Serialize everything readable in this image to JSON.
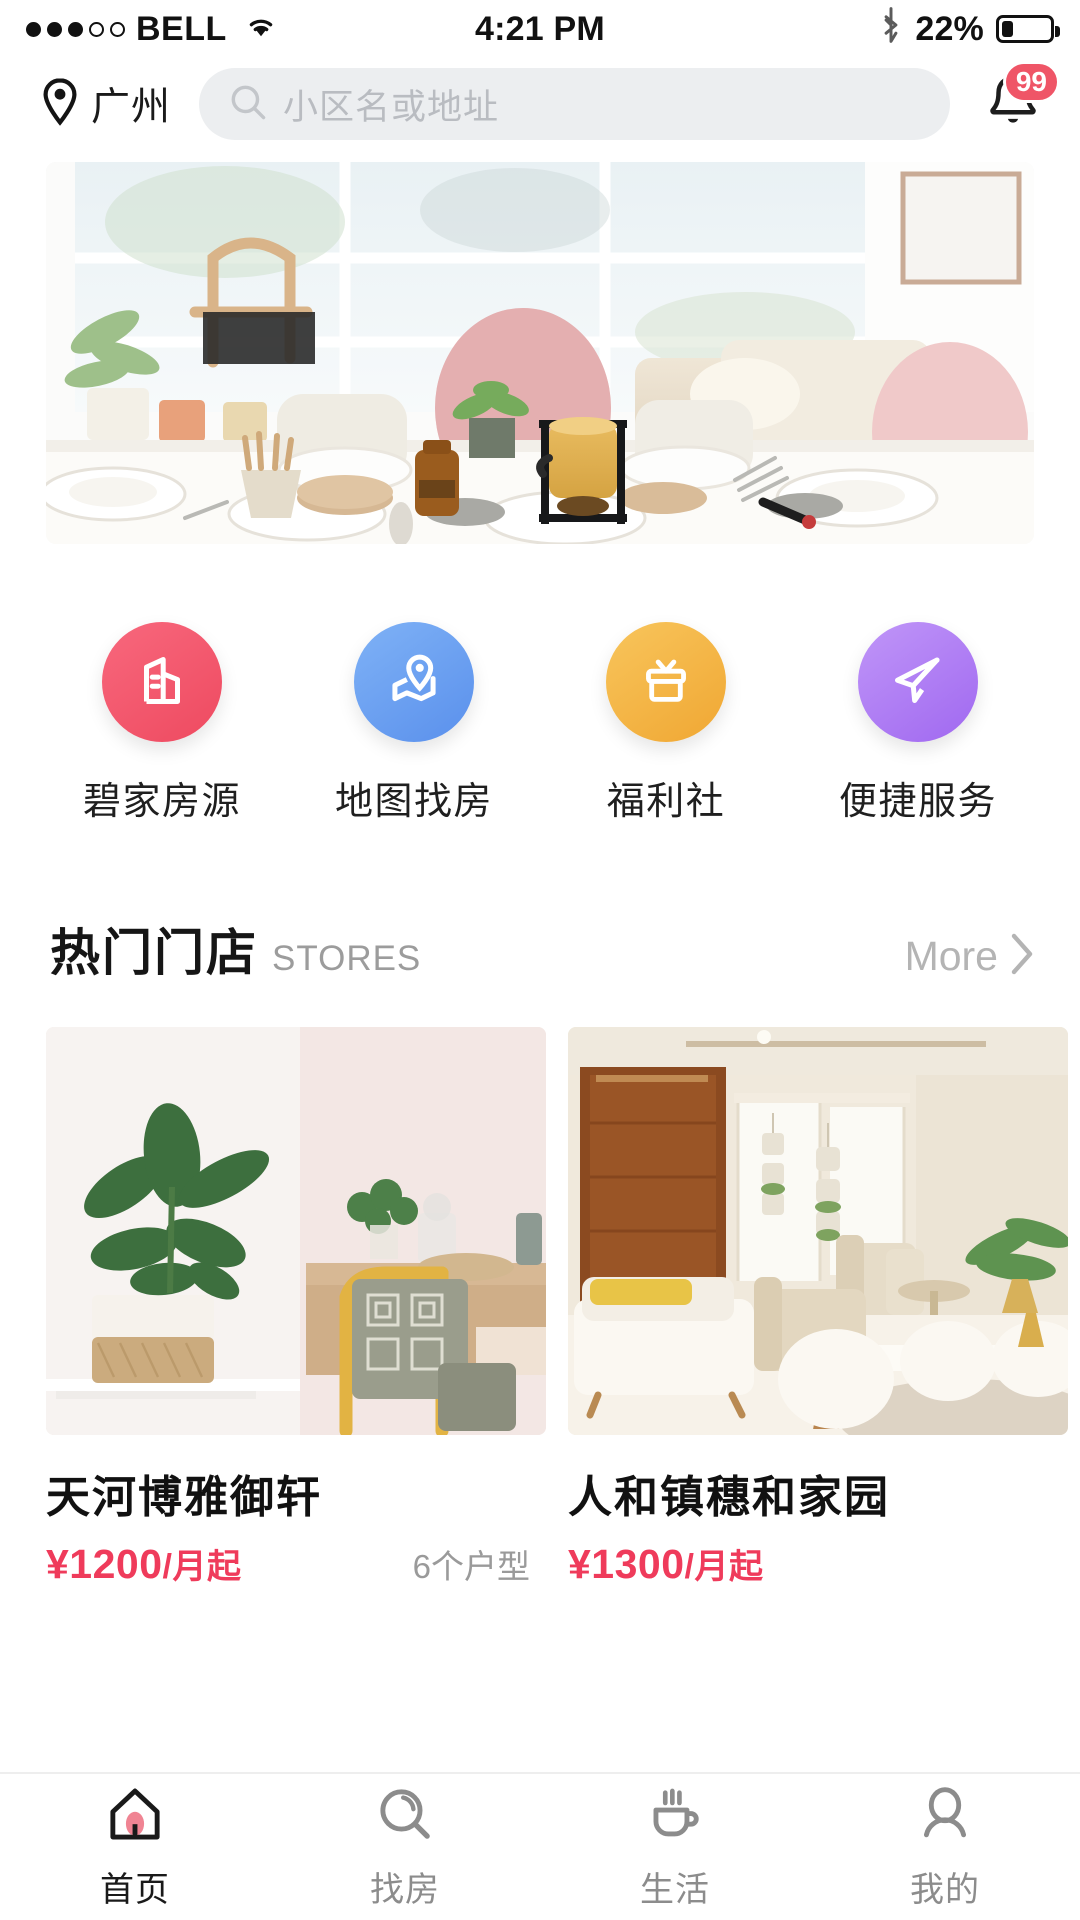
{
  "status_bar": {
    "signal_dots_filled": 3,
    "signal_dots_total": 5,
    "carrier": "BELL",
    "wifi_icon": "wifi-icon",
    "time": "4:21 PM",
    "bluetooth_icon": "bluetooth-icon",
    "battery_percent": "22%",
    "battery_level": 22
  },
  "header": {
    "location_icon": "location-pin-icon",
    "city": "广州",
    "search": {
      "icon": "search-icon",
      "placeholder": "小区名或地址",
      "value": ""
    },
    "notification": {
      "icon": "bell-icon",
      "badge": "99"
    }
  },
  "hero": {
    "alt": "bright-dining-room-banner"
  },
  "quick_actions": [
    {
      "label": "碧家房源",
      "icon": "building-icon",
      "color": "#f4586c",
      "color2": "#ef4f63"
    },
    {
      "label": "地图找房",
      "icon": "map-pin-icon",
      "color": "#6ba4f2",
      "color2": "#5c95ee"
    },
    {
      "label": "福利社",
      "icon": "gift-box-icon",
      "color": "#f5b949",
      "color2": "#f2a93a"
    },
    {
      "label": "便捷服务",
      "icon": "paper-plane-icon",
      "color": "#b583f5",
      "color2": "#a36ff2"
    }
  ],
  "stores_section": {
    "title": "热门门店",
    "subtitle": "STORES",
    "more_label": "More",
    "more_icon": "chevron-right-icon"
  },
  "stores": [
    {
      "name": "天河博雅御轩",
      "price": "¥1200",
      "price_unit": "/月起",
      "unit_types": "6个户型",
      "image_alt": "plant-and-chair-interior"
    },
    {
      "name": "人和镇穗和家园",
      "price": "¥1300",
      "price_unit": "/月起",
      "unit_types": "",
      "image_alt": "living-room-wood-door-interior"
    }
  ],
  "tabbar": [
    {
      "label": "首页",
      "icon": "home-icon",
      "active": true
    },
    {
      "label": "找房",
      "icon": "search-icon",
      "active": false
    },
    {
      "label": "生活",
      "icon": "coffee-cup-icon",
      "active": false
    },
    {
      "label": "我的",
      "icon": "user-icon",
      "active": false
    }
  ],
  "colors": {
    "accent_pink": "#ef3b5b",
    "badge_red": "#ef5567",
    "search_bg": "#eceef0",
    "muted_text": "#9a9a9a"
  }
}
